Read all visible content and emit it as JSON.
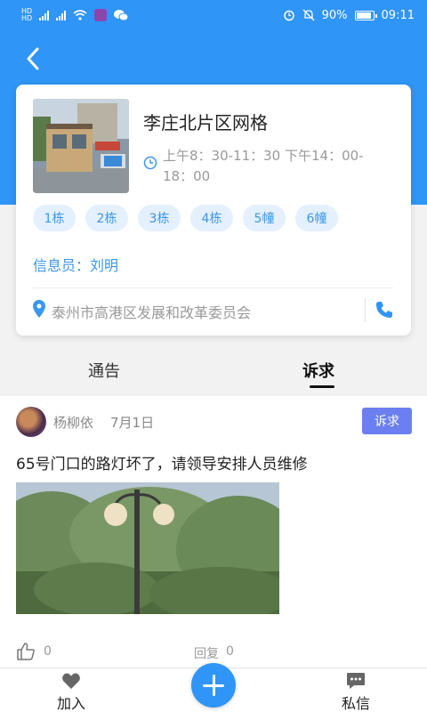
{
  "status_bar": {
    "battery_percent": "90%",
    "time": "09:11"
  },
  "grid": {
    "title": "李庄北片区网格",
    "hours": "上午8：30-11：30 下午14：00-18：00",
    "buildings": [
      "1栋",
      "2栋",
      "3栋",
      "4栋",
      "5幢",
      "6幢"
    ],
    "info_officer": "信息员：刘明",
    "address": "泰州市高港区发展和改革委员会"
  },
  "tabs": {
    "notice": "通告",
    "appeal": "诉求",
    "active": "appeal"
  },
  "post": {
    "author": "杨柳依",
    "date": "7月1日",
    "badge": "诉求",
    "text": "65号门口的路灯坏了，请领导安排人员维修",
    "likes": "0",
    "reply_label": "回复",
    "replies": "0"
  },
  "bottom_nav": {
    "join": "加入",
    "messages": "私信"
  },
  "colors": {
    "primary": "#2f95f6",
    "tag_bg": "#e4f0fd",
    "tag_text": "#3b97ea",
    "badge": "#6b7ff0"
  }
}
